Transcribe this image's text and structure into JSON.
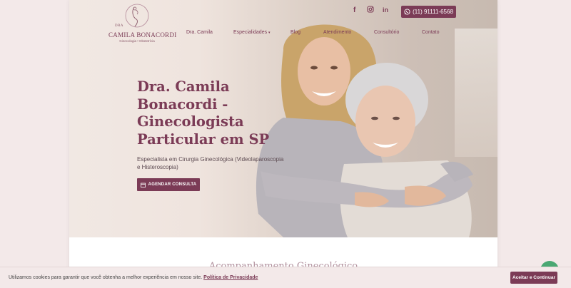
{
  "logo": {
    "pre": "DRA",
    "name": "CAMILA BONACORDI",
    "sub": "Ginecologia • Obstetrícia"
  },
  "header": {
    "social": [
      "facebook-icon",
      "instagram-icon",
      "linkedin-icon"
    ],
    "whatsapp_label": "(11) 91111-6568"
  },
  "nav": {
    "items": [
      {
        "label": "Dra. Camila"
      },
      {
        "label": "Especialidades"
      },
      {
        "label": "Blog"
      },
      {
        "label": "Atendimento"
      },
      {
        "label": "Consultório"
      },
      {
        "label": "Contato"
      }
    ]
  },
  "hero": {
    "title": "Dra. Camila Bonacordi - Ginecologista Particular em SP",
    "subtitle": "Especialista em Cirurgia Ginecológica (Videolaparoscopia e Histeroscopia)",
    "cta_label": "AGENDAR CONSULTA"
  },
  "section": {
    "title": "Acompanhamento Ginecológico"
  },
  "cookie": {
    "text": "Utilizamos cookies para garantir que você obtenha a melhor experiência em nosso site.",
    "link": "Política de Privacidade",
    "button": "Aceitar e Continuar"
  },
  "colors": {
    "brand": "#7b3b56",
    "whatsapp_chat": "#4aa873"
  }
}
